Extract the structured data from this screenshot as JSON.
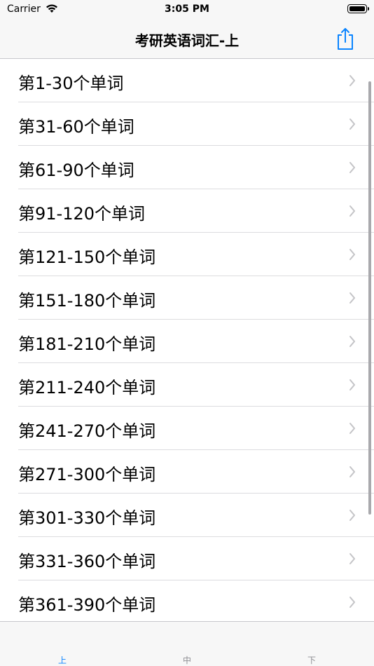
{
  "status_bar": {
    "carrier": "Carrier",
    "time": "3:05 PM"
  },
  "nav": {
    "title": "考研英语词汇-上",
    "accent": "#0a84ff"
  },
  "list": {
    "items": [
      "第1-30个单词",
      "第31-60个单词",
      "第61-90个单词",
      "第91-120个单词",
      "第121-150个单词",
      "第151-180个单词",
      "第181-210个单词",
      "第211-240个单词",
      "第241-270个单词",
      "第271-300个单词",
      "第301-330个单词",
      "第331-360个单词",
      "第361-390个单词"
    ]
  },
  "tabs": [
    {
      "label": "上",
      "active": true
    },
    {
      "label": "中",
      "active": false
    },
    {
      "label": "下",
      "active": false
    }
  ]
}
